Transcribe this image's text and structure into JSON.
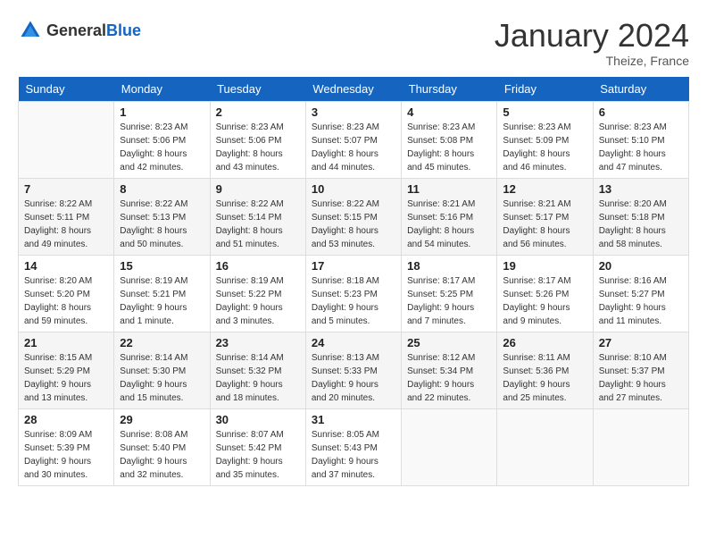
{
  "header": {
    "logo_general": "General",
    "logo_blue": "Blue",
    "month_title": "January 2024",
    "location": "Theize, France"
  },
  "days_of_week": [
    "Sunday",
    "Monday",
    "Tuesday",
    "Wednesday",
    "Thursday",
    "Friday",
    "Saturday"
  ],
  "weeks": [
    [
      {
        "day": "",
        "info": ""
      },
      {
        "day": "1",
        "info": "Sunrise: 8:23 AM\nSunset: 5:06 PM\nDaylight: 8 hours\nand 42 minutes."
      },
      {
        "day": "2",
        "info": "Sunrise: 8:23 AM\nSunset: 5:06 PM\nDaylight: 8 hours\nand 43 minutes."
      },
      {
        "day": "3",
        "info": "Sunrise: 8:23 AM\nSunset: 5:07 PM\nDaylight: 8 hours\nand 44 minutes."
      },
      {
        "day": "4",
        "info": "Sunrise: 8:23 AM\nSunset: 5:08 PM\nDaylight: 8 hours\nand 45 minutes."
      },
      {
        "day": "5",
        "info": "Sunrise: 8:23 AM\nSunset: 5:09 PM\nDaylight: 8 hours\nand 46 minutes."
      },
      {
        "day": "6",
        "info": "Sunrise: 8:23 AM\nSunset: 5:10 PM\nDaylight: 8 hours\nand 47 minutes."
      }
    ],
    [
      {
        "day": "7",
        "info": "Sunrise: 8:22 AM\nSunset: 5:11 PM\nDaylight: 8 hours\nand 49 minutes."
      },
      {
        "day": "8",
        "info": "Sunrise: 8:22 AM\nSunset: 5:13 PM\nDaylight: 8 hours\nand 50 minutes."
      },
      {
        "day": "9",
        "info": "Sunrise: 8:22 AM\nSunset: 5:14 PM\nDaylight: 8 hours\nand 51 minutes."
      },
      {
        "day": "10",
        "info": "Sunrise: 8:22 AM\nSunset: 5:15 PM\nDaylight: 8 hours\nand 53 minutes."
      },
      {
        "day": "11",
        "info": "Sunrise: 8:21 AM\nSunset: 5:16 PM\nDaylight: 8 hours\nand 54 minutes."
      },
      {
        "day": "12",
        "info": "Sunrise: 8:21 AM\nSunset: 5:17 PM\nDaylight: 8 hours\nand 56 minutes."
      },
      {
        "day": "13",
        "info": "Sunrise: 8:20 AM\nSunset: 5:18 PM\nDaylight: 8 hours\nand 58 minutes."
      }
    ],
    [
      {
        "day": "14",
        "info": "Sunrise: 8:20 AM\nSunset: 5:20 PM\nDaylight: 8 hours\nand 59 minutes."
      },
      {
        "day": "15",
        "info": "Sunrise: 8:19 AM\nSunset: 5:21 PM\nDaylight: 9 hours\nand 1 minute."
      },
      {
        "day": "16",
        "info": "Sunrise: 8:19 AM\nSunset: 5:22 PM\nDaylight: 9 hours\nand 3 minutes."
      },
      {
        "day": "17",
        "info": "Sunrise: 8:18 AM\nSunset: 5:23 PM\nDaylight: 9 hours\nand 5 minutes."
      },
      {
        "day": "18",
        "info": "Sunrise: 8:17 AM\nSunset: 5:25 PM\nDaylight: 9 hours\nand 7 minutes."
      },
      {
        "day": "19",
        "info": "Sunrise: 8:17 AM\nSunset: 5:26 PM\nDaylight: 9 hours\nand 9 minutes."
      },
      {
        "day": "20",
        "info": "Sunrise: 8:16 AM\nSunset: 5:27 PM\nDaylight: 9 hours\nand 11 minutes."
      }
    ],
    [
      {
        "day": "21",
        "info": "Sunrise: 8:15 AM\nSunset: 5:29 PM\nDaylight: 9 hours\nand 13 minutes."
      },
      {
        "day": "22",
        "info": "Sunrise: 8:14 AM\nSunset: 5:30 PM\nDaylight: 9 hours\nand 15 minutes."
      },
      {
        "day": "23",
        "info": "Sunrise: 8:14 AM\nSunset: 5:32 PM\nDaylight: 9 hours\nand 18 minutes."
      },
      {
        "day": "24",
        "info": "Sunrise: 8:13 AM\nSunset: 5:33 PM\nDaylight: 9 hours\nand 20 minutes."
      },
      {
        "day": "25",
        "info": "Sunrise: 8:12 AM\nSunset: 5:34 PM\nDaylight: 9 hours\nand 22 minutes."
      },
      {
        "day": "26",
        "info": "Sunrise: 8:11 AM\nSunset: 5:36 PM\nDaylight: 9 hours\nand 25 minutes."
      },
      {
        "day": "27",
        "info": "Sunrise: 8:10 AM\nSunset: 5:37 PM\nDaylight: 9 hours\nand 27 minutes."
      }
    ],
    [
      {
        "day": "28",
        "info": "Sunrise: 8:09 AM\nSunset: 5:39 PM\nDaylight: 9 hours\nand 30 minutes."
      },
      {
        "day": "29",
        "info": "Sunrise: 8:08 AM\nSunset: 5:40 PM\nDaylight: 9 hours\nand 32 minutes."
      },
      {
        "day": "30",
        "info": "Sunrise: 8:07 AM\nSunset: 5:42 PM\nDaylight: 9 hours\nand 35 minutes."
      },
      {
        "day": "31",
        "info": "Sunrise: 8:05 AM\nSunset: 5:43 PM\nDaylight: 9 hours\nand 37 minutes."
      },
      {
        "day": "",
        "info": ""
      },
      {
        "day": "",
        "info": ""
      },
      {
        "day": "",
        "info": ""
      }
    ]
  ]
}
